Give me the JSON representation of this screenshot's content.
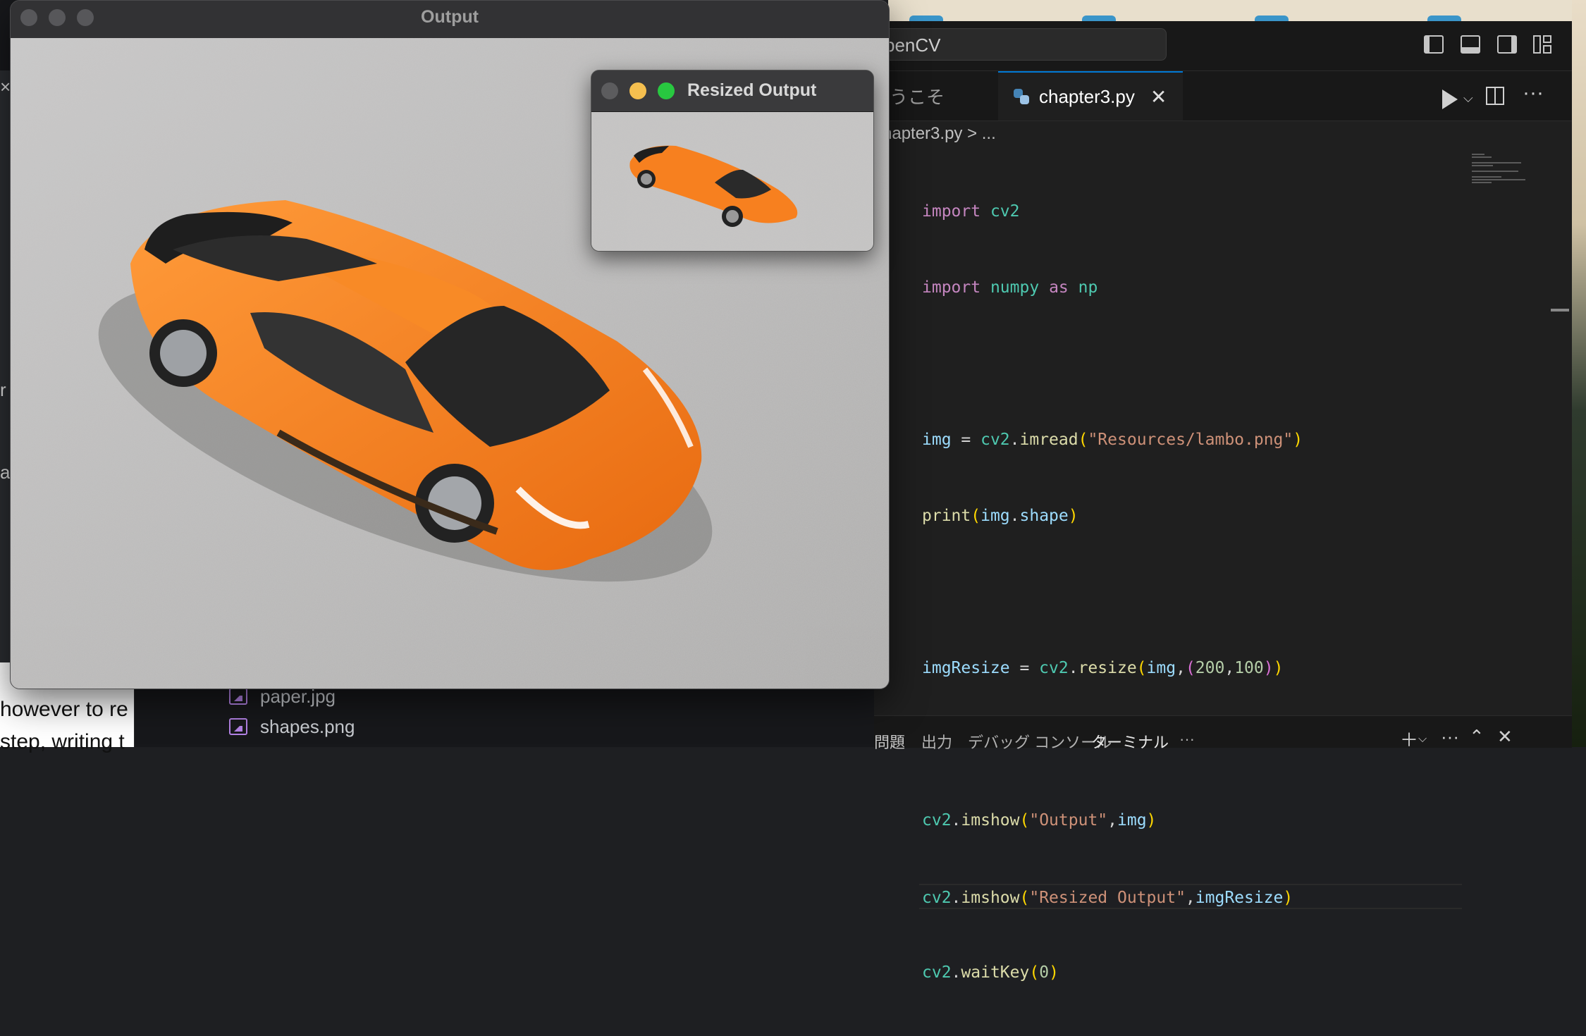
{
  "background_app": {
    "visible_text_lines": [
      "however to re",
      "step, writing t"
    ],
    "edge_glyphs": [
      "×",
      "r",
      "a"
    ],
    "files": [
      {
        "name": "paper.jpg",
        "icon": "image-file-icon"
      },
      {
        "name": "shapes.png",
        "icon": "image-file-icon"
      }
    ]
  },
  "vscode": {
    "search_text": "penCV",
    "tabs": [
      {
        "label": "うこそ",
        "active": false
      },
      {
        "label": "chapter3.py",
        "active": true,
        "close": "✕"
      }
    ],
    "breadcrumb": "chapter3.py  >  ...",
    "code_lines": [
      "import cv2",
      "import numpy as np",
      "",
      "img = cv2.imread(\"Resources/lambo.png\")",
      "print(img.shape)",
      "",
      "imgResize = cv2.resize(img,(200,100))",
      "",
      "cv2.imshow(\"Output\",img)",
      "cv2.imshow(\"Resized Output\",imgResize)",
      "cv2.waitKey(0)"
    ],
    "panel_tabs": [
      "問題",
      "出力",
      "デバッグ コンソール",
      "ターミナル",
      "···"
    ],
    "colors": {
      "keyword": "#c586c0",
      "module": "#4ec9b0",
      "function": "#dcdcaa",
      "string": "#ce9178",
      "variable": "#9cdcfe",
      "number": "#b5cea8",
      "accent": "#0078d4"
    }
  },
  "output_window": {
    "title": "Output",
    "image_subject": "orange toy sports car on grey carpet",
    "car_color": "#f7801f"
  },
  "resized_window": {
    "title": "Resized Output"
  }
}
